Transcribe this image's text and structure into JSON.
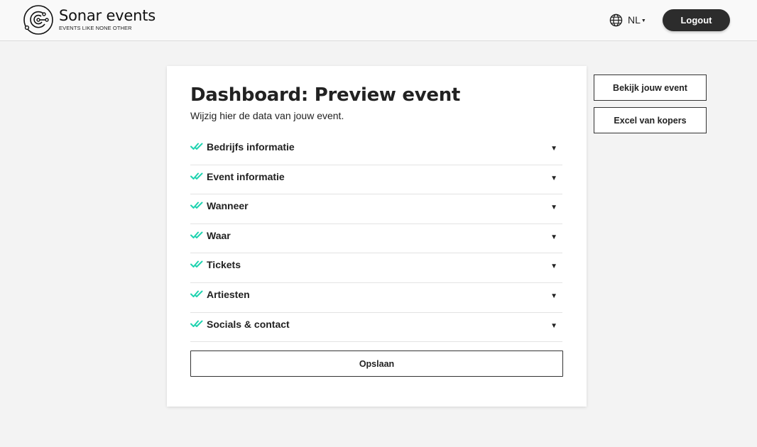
{
  "header": {
    "logo_icon": "sonar-logo-icon",
    "logo_title": "Sonar events",
    "logo_subtitle": "EVENTS LIKE NONE OTHER",
    "language_icon": "globe-icon",
    "language": "NL",
    "logout_label": "Logout"
  },
  "main": {
    "title": "Dashboard: Preview event",
    "subtitle": "Wijzig hier de data van jouw event.",
    "check_icon": "double-check-icon",
    "check_color": "#1fd3b0",
    "sections": [
      {
        "label": "Bedrijfs informatie"
      },
      {
        "label": "Event informatie"
      },
      {
        "label": "Wanneer"
      },
      {
        "label": "Waar"
      },
      {
        "label": "Tickets"
      },
      {
        "label": "Artiesten"
      },
      {
        "label": "Socials & contact"
      }
    ],
    "save_label": "Opslaan"
  },
  "side_actions": {
    "view_event_label": "Bekijk jouw event",
    "excel_label": "Excel van kopers"
  }
}
